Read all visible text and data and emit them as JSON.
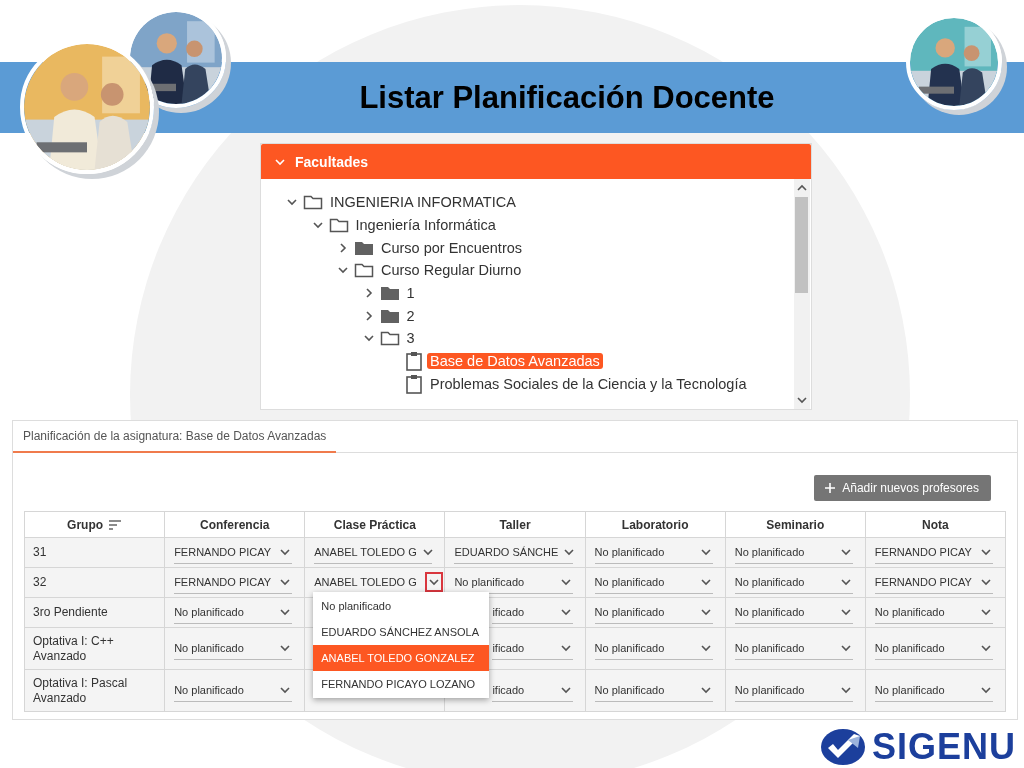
{
  "header": {
    "title": "Listar Planificación Docente"
  },
  "tree": {
    "title": "Facultades",
    "expanded": true,
    "items": [
      {
        "label": "INGENIERIA INFORMATICA",
        "kind": "folder",
        "expanded": true,
        "children": [
          {
            "label": "Ingeniería Informática",
            "kind": "folder",
            "expanded": true,
            "children": [
              {
                "label": "Curso por Encuentros",
                "kind": "folder",
                "expanded": false
              },
              {
                "label": "Curso Regular Diurno",
                "kind": "folder",
                "expanded": true,
                "children": [
                  {
                    "label": "1",
                    "kind": "folder",
                    "expanded": false
                  },
                  {
                    "label": "2",
                    "kind": "folder",
                    "expanded": false
                  },
                  {
                    "label": "3",
                    "kind": "folder",
                    "expanded": true,
                    "children": [
                      {
                        "label": "Base de Datos Avanzadas",
                        "kind": "subject",
                        "selected": true
                      },
                      {
                        "label": "Problemas Sociales de la Ciencia y la Tecnología",
                        "kind": "subject",
                        "selected": false
                      }
                    ]
                  }
                ]
              }
            ]
          }
        ]
      }
    ]
  },
  "plan": {
    "tab": {
      "label": "Planificación de la asignatura: Base de Datos Avanzadas",
      "selected": true
    },
    "add_button": "Añadir nuevos profesores",
    "columns": [
      {
        "label": "Grupo",
        "sortable": true
      },
      {
        "label": "Conferencia",
        "sortable": false
      },
      {
        "label": "Clase Práctica",
        "sortable": false
      },
      {
        "label": "Taller",
        "sortable": false
      },
      {
        "label": "Laboratorio",
        "sortable": false
      },
      {
        "label": "Seminario",
        "sortable": false
      },
      {
        "label": "Nota",
        "sortable": false
      }
    ],
    "rows": [
      {
        "cells": [
          {
            "kind": "text",
            "value": "31"
          },
          {
            "value": "FERNANDO PICAY"
          },
          {
            "value": "ANABEL TOLEDO G"
          },
          {
            "value": "EDUARDO SÁNCHE"
          },
          {
            "value": "No planificado"
          },
          {
            "value": "No planificado"
          },
          {
            "value": "FERNANDO PICAY"
          }
        ]
      },
      {
        "cells": [
          {
            "kind": "text",
            "value": "32"
          },
          {
            "value": "FERNANDO PICAY"
          },
          {
            "value": "ANABEL TOLEDO G",
            "options": [
              {
                "label": "No planificado",
                "selected": false
              },
              {
                "label": "EDUARDO SÁNCHEZ ANSOLA",
                "selected": false
              },
              {
                "label": "ANABEL TOLEDO GONZALEZ",
                "selected": true
              },
              {
                "label": "FERNANDO PICAYO LOZANO",
                "selected": false
              }
            ]
          },
          {
            "value": "No planificado"
          },
          {
            "value": "No planificado"
          },
          {
            "value": "No planificado"
          },
          {
            "value": "FERNANDO PICAY"
          }
        ]
      },
      {
        "cells": [
          {
            "kind": "text",
            "value": "3ro Pendiente"
          },
          {
            "value": "No planificado"
          },
          null,
          {
            "value": "ificado",
            "covered": true
          },
          {
            "value": "No planificado"
          },
          {
            "value": "No planificado"
          },
          {
            "value": "No planificado"
          }
        ]
      },
      {
        "cells": [
          {
            "kind": "text",
            "value": "Optativa I: C++ Avanzado"
          },
          {
            "value": "No planificado"
          },
          null,
          {
            "value": "ificado",
            "covered": true
          },
          {
            "value": "No planificado"
          },
          {
            "value": "No planificado"
          },
          {
            "value": "No planificado"
          }
        ]
      },
      {
        "cells": [
          {
            "kind": "text",
            "value": "Optativa I: Pascal Avanzado"
          },
          {
            "value": "No planificado"
          },
          null,
          {
            "value": "ificado",
            "covered": true
          },
          {
            "value": "No planificado"
          },
          {
            "value": "No planificado"
          },
          {
            "value": "No planificado"
          }
        ]
      }
    ]
  },
  "logo": {
    "text": "SIGENU"
  }
}
